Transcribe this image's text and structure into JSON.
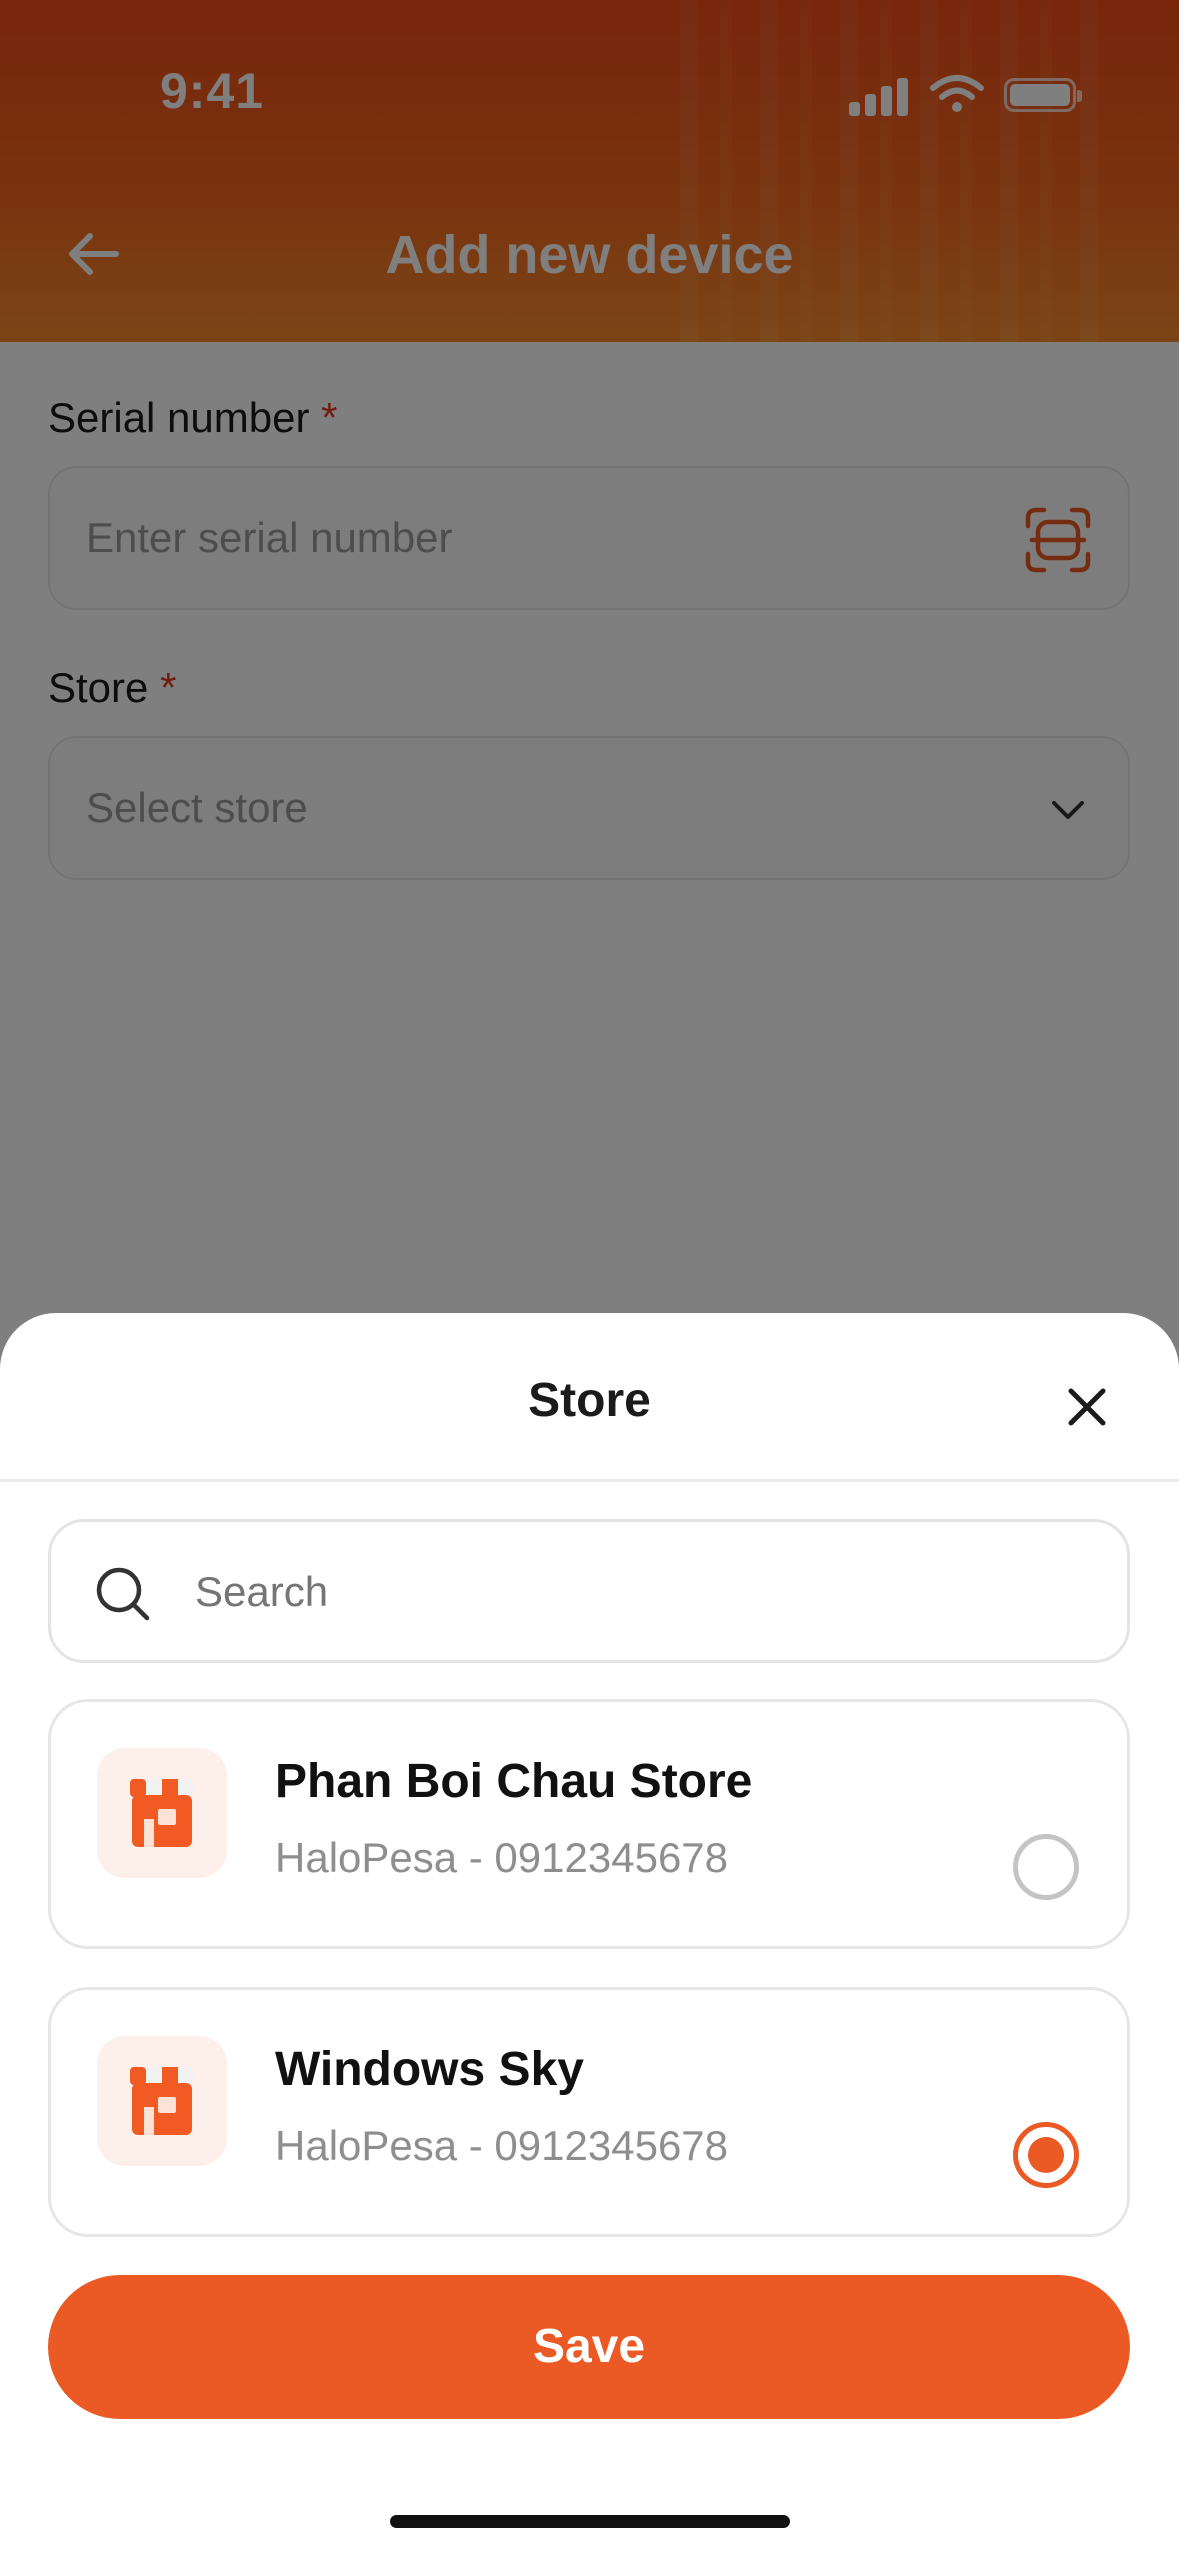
{
  "status_bar": {
    "time": "9:41"
  },
  "header": {
    "title": "Add new device",
    "back_icon": "arrow-left-icon"
  },
  "form": {
    "serial": {
      "label": "Serial number",
      "required_mark": "*",
      "placeholder": "Enter serial number",
      "icon": "scan-icon"
    },
    "store": {
      "label": "Store",
      "required_mark": "*",
      "placeholder": "Select store",
      "icon": "chevron-down-icon"
    }
  },
  "sheet": {
    "title": "Store",
    "close_icon": "close-icon",
    "search": {
      "placeholder": "Search",
      "icon": "search-icon"
    },
    "stores": [
      {
        "name": "Phan Boi Chau Store",
        "subtitle": "HaloPesa - 0912345678",
        "selected": false
      },
      {
        "name": "Windows Sky",
        "subtitle": "HaloPesa - 0912345678",
        "selected": true
      }
    ],
    "save_label": "Save"
  },
  "colors": {
    "accent": "#eb5a24",
    "header_start": "#f04a18",
    "header_end": "#f88a2c",
    "required": "#e5391f"
  }
}
